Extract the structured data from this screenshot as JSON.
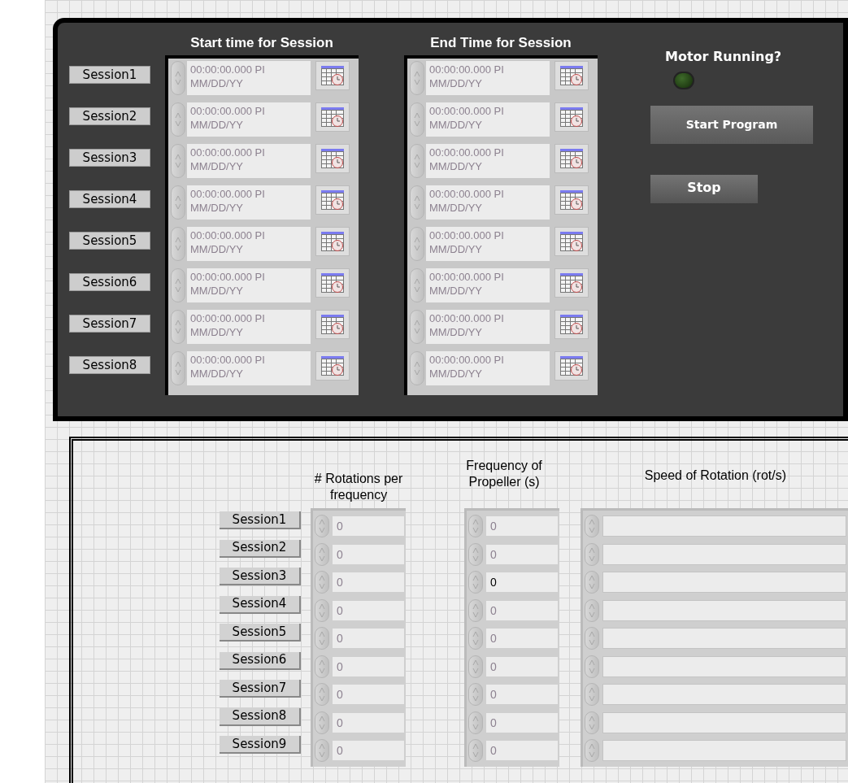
{
  "session_panel": {
    "start_header": "Start time for Session",
    "end_header": "End Time for Session",
    "sessions": [
      {
        "label": "Session1",
        "start_time": "00:00:00.000 PI",
        "start_date": "MM/DD/YY",
        "end_time": "00:00:00.000 PI",
        "end_date": "MM/DD/YY"
      },
      {
        "label": "Session2",
        "start_time": "00:00:00.000 PI",
        "start_date": "MM/DD/YY",
        "end_time": "00:00:00.000 PI",
        "end_date": "MM/DD/YY"
      },
      {
        "label": "Session3",
        "start_time": "00:00:00.000 PI",
        "start_date": "MM/DD/YY",
        "end_time": "00:00:00.000 PI",
        "end_date": "MM/DD/YY"
      },
      {
        "label": "Session4",
        "start_time": "00:00:00.000 PI",
        "start_date": "MM/DD/YY",
        "end_time": "00:00:00.000 PI",
        "end_date": "MM/DD/YY"
      },
      {
        "label": "Session5",
        "start_time": "00:00:00.000 PI",
        "start_date": "MM/DD/YY",
        "end_time": "00:00:00.000 PI",
        "end_date": "MM/DD/YY"
      },
      {
        "label": "Session6",
        "start_time": "00:00:00.000 PI",
        "start_date": "MM/DD/YY",
        "end_time": "00:00:00.000 PI",
        "end_date": "MM/DD/YY"
      },
      {
        "label": "Session7",
        "start_time": "00:00:00.000 PI",
        "start_date": "MM/DD/YY",
        "end_time": "00:00:00.000 PI",
        "end_date": "MM/DD/YY"
      },
      {
        "label": "Session8",
        "start_time": "00:00:00.000 PI",
        "start_date": "MM/DD/YY",
        "end_time": "00:00:00.000 PI",
        "end_date": "MM/DD/YY"
      }
    ],
    "motor_indicator": {
      "label": "Motor Running?",
      "on": false
    },
    "start_button": "Start Program",
    "stop_button": "Stop"
  },
  "rotation_panel": {
    "headers": [
      "# Rotations per frequency",
      "Frequency of Propeller (s)",
      "Speed of Rotation (rot/s)"
    ],
    "rows": [
      {
        "label": "Session1",
        "rotations": "0",
        "frequency": "0",
        "frequency_active": false
      },
      {
        "label": "Session2",
        "rotations": "0",
        "frequency": "0",
        "frequency_active": false
      },
      {
        "label": "Session3",
        "rotations": "0",
        "frequency": "0",
        "frequency_active": true
      },
      {
        "label": "Session4",
        "rotations": "0",
        "frequency": "0",
        "frequency_active": false
      },
      {
        "label": "Session5",
        "rotations": "0",
        "frequency": "0",
        "frequency_active": false
      },
      {
        "label": "Session6",
        "rotations": "0",
        "frequency": "0",
        "frequency_active": false
      },
      {
        "label": "Session7",
        "rotations": "0",
        "frequency": "0",
        "frequency_active": false
      },
      {
        "label": "Session8",
        "rotations": "0",
        "frequency": "0",
        "frequency_active": false
      },
      {
        "label": "Session9",
        "rotations": "0",
        "frequency": "0",
        "frequency_active": false
      }
    ]
  }
}
